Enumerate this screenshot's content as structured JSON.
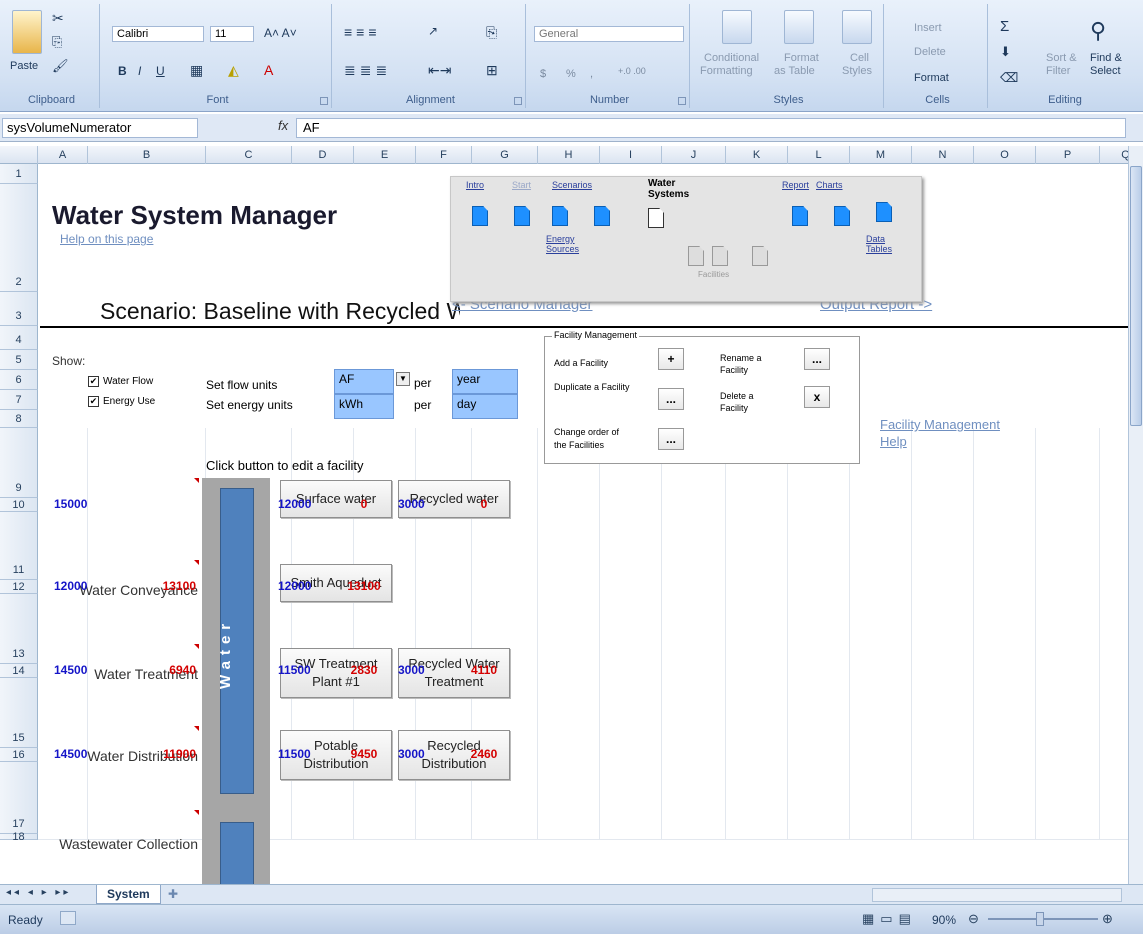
{
  "ribbon": {
    "clipboard": {
      "paste": "Paste",
      "title": "Clipboard"
    },
    "font": {
      "name": "Calibri",
      "size": "11",
      "title": "Font"
    },
    "alignment": {
      "title": "Alignment"
    },
    "number": {
      "format": "General",
      "title": "Number",
      "currency": "$",
      "percent": "%",
      "comma": ",",
      "inc_decimal": "+.0 .00",
      "dec_decimal": ".00 +.0"
    },
    "styles": {
      "conditional": "Conditional",
      "conditional2": "Formatting",
      "format_table": "Format",
      "format_table2": "as Table",
      "cell_styles": "Cell",
      "cell_styles2": "Styles",
      "title": "Styles"
    },
    "cells": {
      "insert": "Insert",
      "delete": "Delete",
      "format": "Format",
      "title": "Cells"
    },
    "editing": {
      "sort": "Sort &",
      "sort2": "Filter",
      "find": "Find &",
      "find2": "Select",
      "title": "Editing"
    }
  },
  "formula_bar": {
    "name_box": "sysVolumeNumerator",
    "fx": "fx",
    "value": "AF"
  },
  "columns": [
    "A",
    "B",
    "C",
    "D",
    "E",
    "F",
    "G",
    "H",
    "I",
    "J",
    "K",
    "L",
    "M",
    "N",
    "O",
    "P",
    "Q"
  ],
  "rows": [
    "1",
    "2",
    "3",
    "4",
    "5",
    "6",
    "7",
    "8",
    "9",
    "10",
    "11",
    "12",
    "13",
    "14",
    "15",
    "16",
    "17",
    "18"
  ],
  "sheet": {
    "title": "Water System Manager",
    "help_link": "Help on this page",
    "scenario": "Scenario: Baseline with Recycled Water",
    "scenario_manager_link": "<- Scenario Manager",
    "output_report_link": "Output Report ->",
    "nav": {
      "intro": "Intro",
      "start": "Start",
      "scenarios": "Scenarios",
      "water": "Water",
      "systems": "Systems",
      "report": "Report",
      "charts": "Charts",
      "energy": "Energy",
      "sources": "Sources",
      "data": "Data",
      "tables": "Tables",
      "facilities": "Facilities"
    },
    "show": "Show:",
    "water_flow": "Water Flow",
    "energy_use": "Energy Use",
    "set_flow_units": "Set flow units",
    "set_energy_units": "Set energy units",
    "flow_unit": "AF",
    "energy_unit": "kWh",
    "per": "per",
    "flow_period": "year",
    "energy_period": "day",
    "facility_mgmt": {
      "title": "Facility Management",
      "add": "Add a Facility",
      "duplicate": "Duplicate a Facility",
      "order": "Change order of the Facilities",
      "rename": "Rename a Facility",
      "delete": "Delete a Facility",
      "plus": "+",
      "dots": "...",
      "x": "x"
    },
    "facility_help": "Facility Management Help",
    "click_hint": "Click button to edit a facility",
    "band_label": "Water",
    "stages": [
      {
        "name": "",
        "flow": "15000",
        "energy": ""
      },
      {
        "name": "Water Conveyance",
        "flow": "12000",
        "energy": "13100"
      },
      {
        "name": "Water Treatment",
        "flow": "14500",
        "energy": "6940"
      },
      {
        "name": "Water Distribution",
        "flow": "14500",
        "energy": "11900"
      },
      {
        "name": "Wastewater Collection",
        "flow": "",
        "energy": ""
      }
    ],
    "facilities": {
      "surface": {
        "label": "Surface water",
        "flow": "12000",
        "energy": "0"
      },
      "recycled": {
        "label": "Recycled water",
        "flow": "3000",
        "energy": "0"
      },
      "smith": {
        "label": "Smith Aqueduct",
        "flow": "12000",
        "energy": "13100"
      },
      "sw_treat": {
        "label": "SW Treatment Plant #1",
        "flow": "11500",
        "energy": "2830"
      },
      "rw_treat": {
        "label": "Recycled Water Treatment",
        "flow": "3000",
        "energy": "4110"
      },
      "potable": {
        "label": "Potable Distribution",
        "flow": "11500",
        "energy": "9450"
      },
      "rec_dist": {
        "label": "Recycled Distribution",
        "flow": "3000",
        "energy": "2460"
      }
    }
  },
  "tabs": {
    "sheet": "System"
  },
  "status": {
    "ready": "Ready",
    "zoom": "90%"
  },
  "colors": {
    "band": "#4f81bd",
    "band_bg": "#a6a6a6",
    "input": "#99c6ff"
  }
}
